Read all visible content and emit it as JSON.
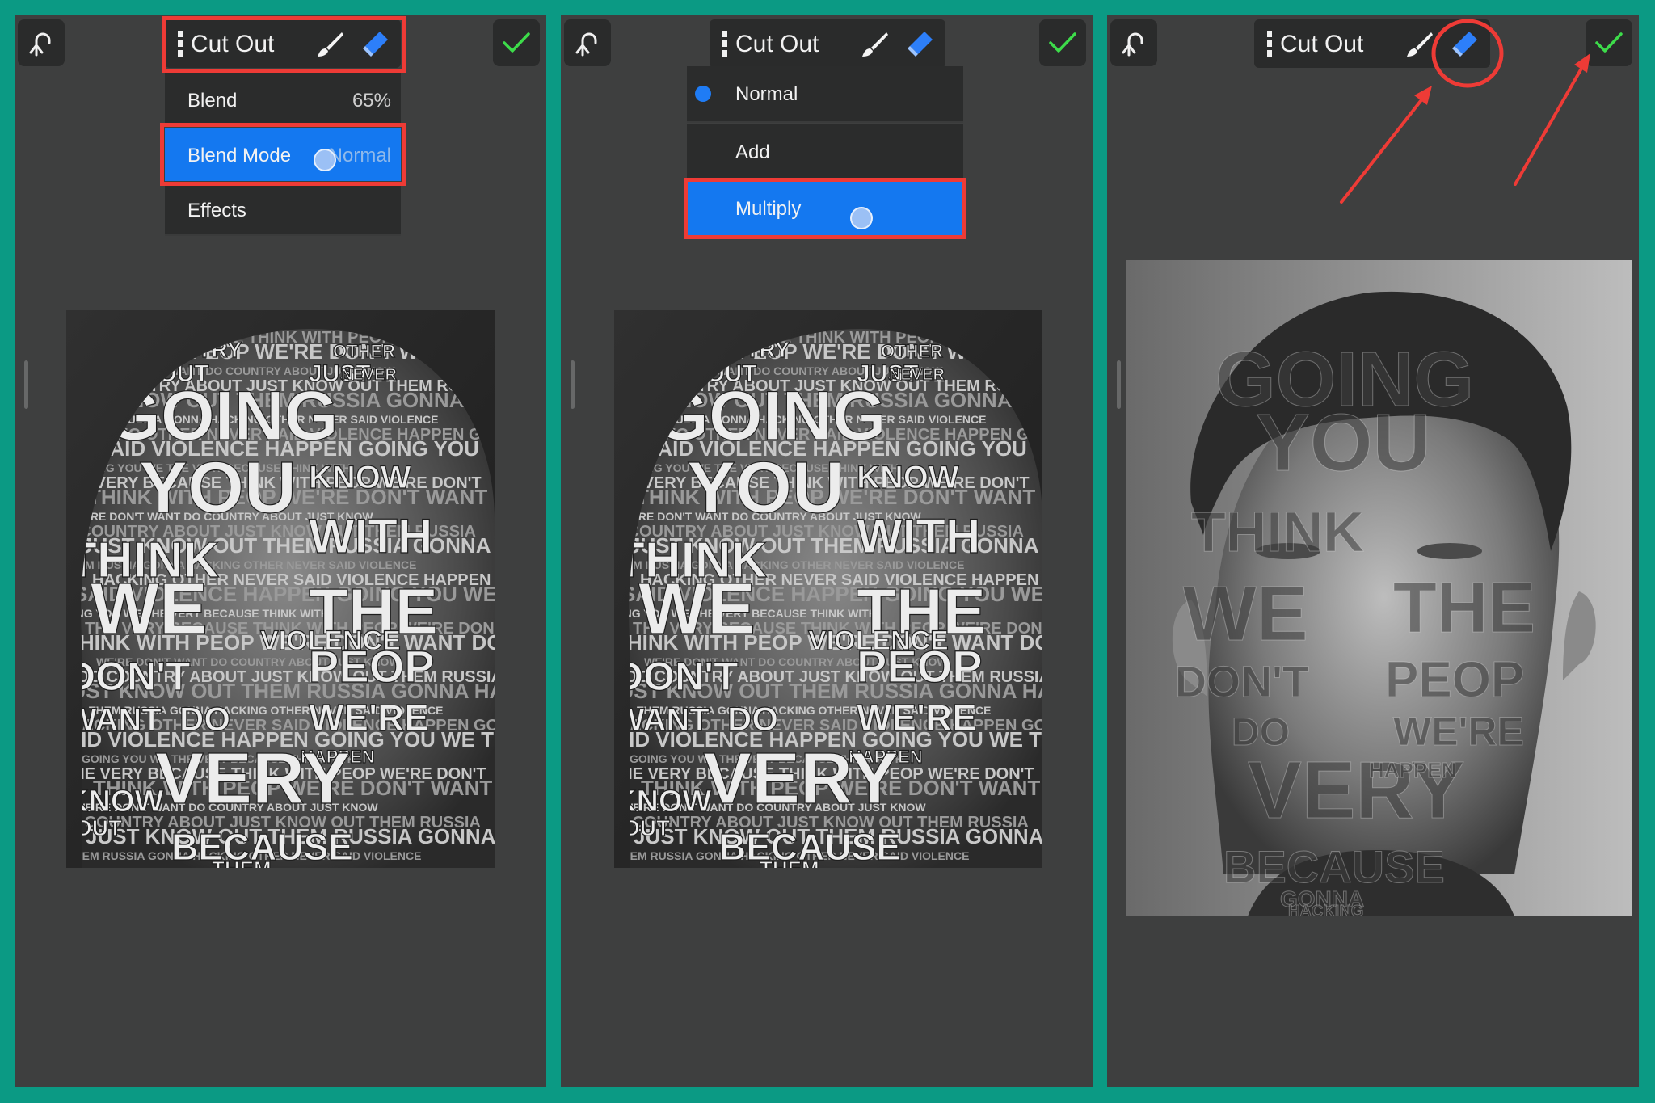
{
  "toolbar": {
    "title": "Cut Out"
  },
  "panel1": {
    "menu": [
      {
        "label": "Blend",
        "value": "65%"
      },
      {
        "label": "Blend Mode",
        "value": "Normal"
      },
      {
        "label": "Effects",
        "value": ""
      }
    ]
  },
  "panel2": {
    "blend_options": [
      {
        "label": "Normal",
        "selected": true
      },
      {
        "label": "Add",
        "selected": false
      },
      {
        "label": "Multiply",
        "selected": false
      }
    ]
  },
  "artwork": {
    "words": [
      "GOING",
      "YOU",
      "WE",
      "THE",
      "VERY",
      "BECAUSE",
      "THINK",
      "WITH",
      "PEOP",
      "WE'RE",
      "DON'T",
      "WANT",
      "DO",
      "COUNTRY",
      "ABOUT",
      "JUST",
      "KNOW",
      "OUT",
      "THEM",
      "RUSSIA",
      "GONNA",
      "HACKING",
      "OTHER",
      "NEVER",
      "SAID",
      "VIOLENCE",
      "HAPPEN"
    ]
  },
  "colors": {
    "background": "#0b9a84",
    "panel": "#3e3f3f",
    "accent": "#1478f0",
    "highlight": "#ee3b36",
    "confirm": "#3ddc4a"
  }
}
